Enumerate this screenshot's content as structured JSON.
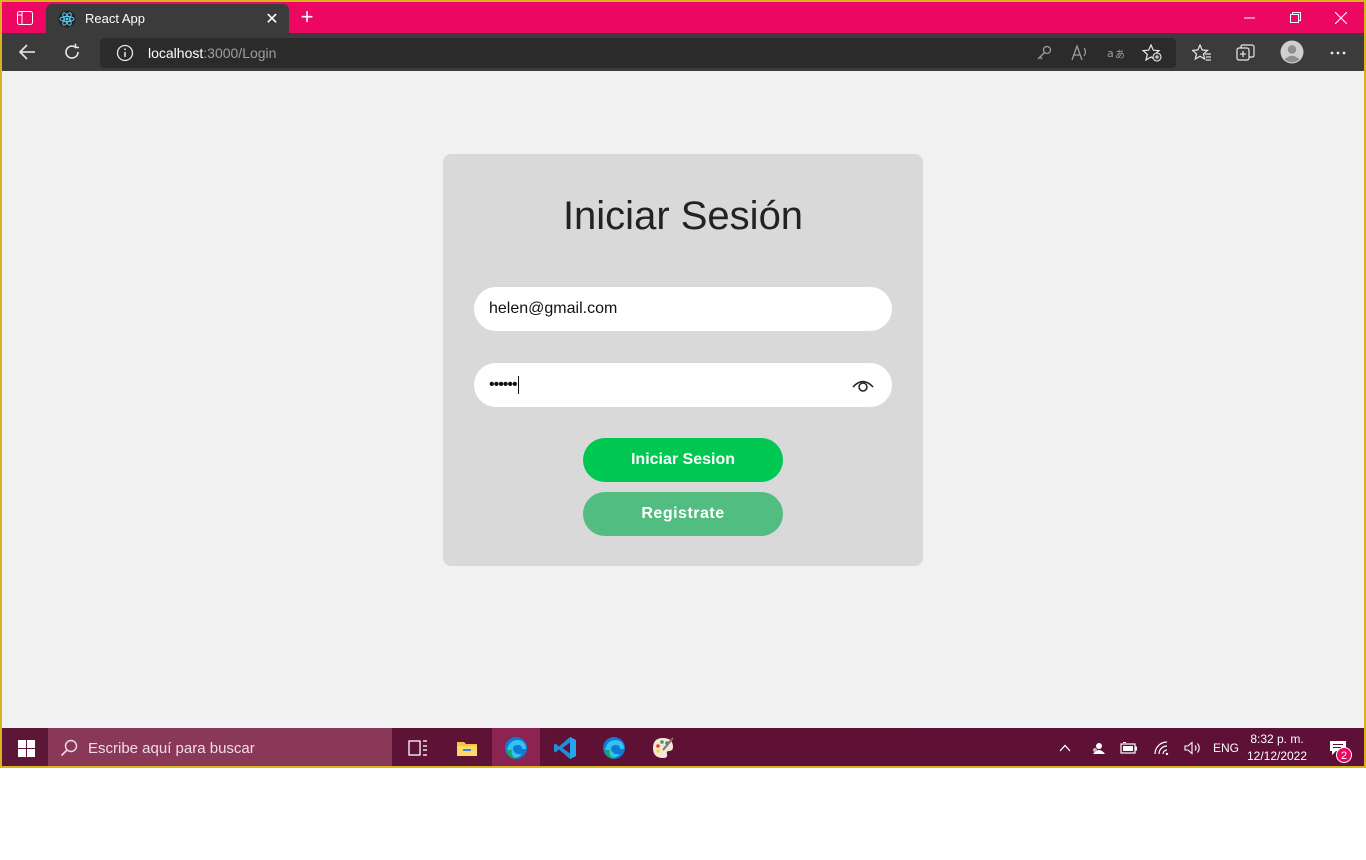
{
  "browser": {
    "tab_title": "React App",
    "tab_close": "✕",
    "new_tab": "+",
    "url_host": "localhost",
    "url_path": ":3000/Login"
  },
  "login": {
    "title": "Iniciar Sesión",
    "email_value": "helen@gmail.com",
    "password_value": "••••••",
    "login_button": "Iniciar Sesion",
    "register_button": "Registrate"
  },
  "taskbar": {
    "search_placeholder": "Escribe aquí para buscar",
    "language": "ENG",
    "time": "8:32 p. m.",
    "date": "12/12/2022",
    "notification_count": "2"
  },
  "colors": {
    "titlebar": "#ec0762",
    "card": "#d9d9d9",
    "login_button": "#00c853",
    "register_button": "#52bd80"
  }
}
